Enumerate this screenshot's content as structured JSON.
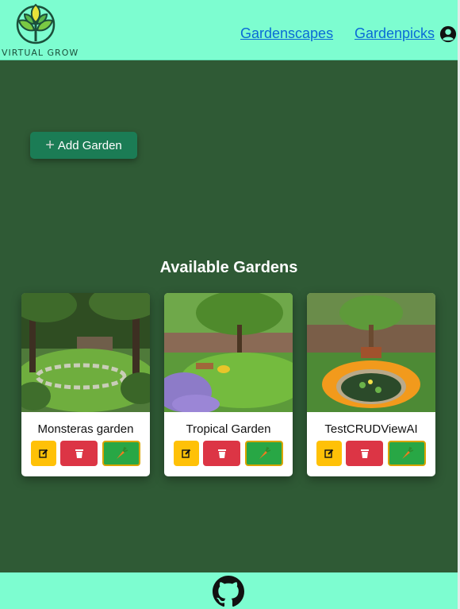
{
  "header": {
    "logo_text": "VIRTUAL GROW",
    "nav": [
      "Gardenscapes",
      "Gardenpicks"
    ],
    "account_icon": "user-circle-icon"
  },
  "main": {
    "add_button_label": "Add Garden",
    "section_title": "Available Gardens",
    "gardens": [
      {
        "name": "Monsteras garden"
      },
      {
        "name": "Tropical Garden"
      },
      {
        "name": "TestCRUDViewAI"
      }
    ],
    "card_actions": {
      "edit_icon": "edit-icon",
      "delete_icon": "trash-icon",
      "grow_icon": "carrot-icon"
    }
  },
  "footer": {
    "icon": "github-icon"
  },
  "colors": {
    "header_bg": "#7dfdd0",
    "page_bg": "#2f5a35",
    "add_button": "#1b7c55",
    "edit": "#ffc107",
    "delete": "#dc3545",
    "grow": "#28a745",
    "link": "#0a6ad6"
  }
}
